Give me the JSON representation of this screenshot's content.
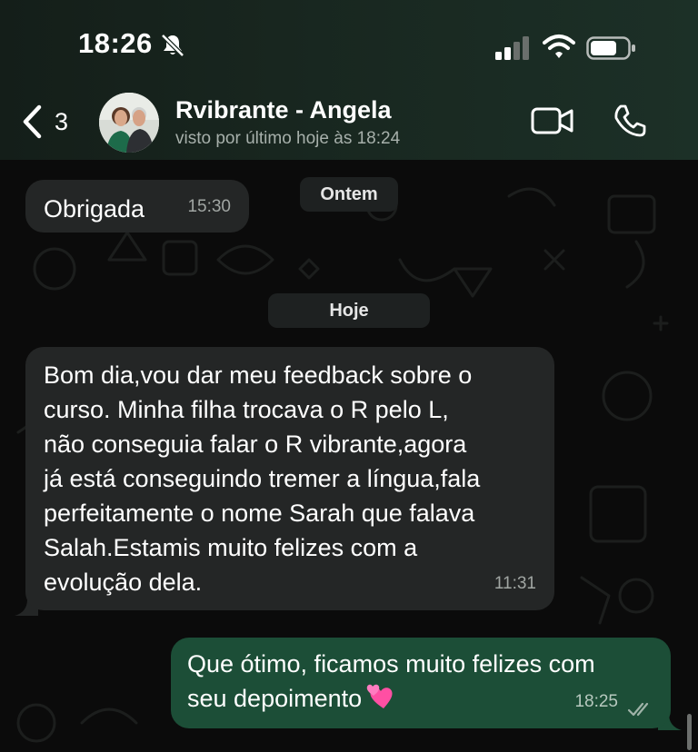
{
  "status_bar": {
    "time": "18:26",
    "icons": [
      "bell-slash-icon",
      "signal-icon",
      "wifi-icon",
      "battery-icon"
    ]
  },
  "header": {
    "back_count": "3",
    "contact_name": "Rvibrante - Angela",
    "contact_status": "visto por último hoje às 18:24",
    "icons": [
      "chevron-left-icon",
      "video-camera-icon",
      "phone-icon"
    ]
  },
  "chat": {
    "date_chips": [
      "Ontem",
      "Hoje"
    ],
    "messages": [
      {
        "direction": "incoming",
        "text": "Obrigada",
        "time": "15:30"
      },
      {
        "direction": "incoming",
        "text": "Bom dia,vou dar meu feedback sobre o\ncurso. Minha filha trocava o R pelo L,\nnão conseguia falar o R vibrante,agora\njá está conseguindo tremer a língua,fala\nperfeitamente o nome Sarah que falava\nSalah.Estamis muito felizes com a\nevolução dela.",
        "time": "11:31"
      },
      {
        "direction": "outgoing",
        "text": "Que ótimo, ficamos muito felizes com\nseu depoimento",
        "time": "18:25",
        "emoji": "two-hearts-emoji",
        "status_icon": "double-check-icon"
      }
    ]
  },
  "colors": {
    "header_background": "#18261f",
    "incoming_bubble": "#242626",
    "outgoing_bubble": "#1c4e37",
    "chat_background": "#0b0b0b",
    "date_chip": "#1e2121",
    "secondary_text": "#a7b0ab"
  }
}
